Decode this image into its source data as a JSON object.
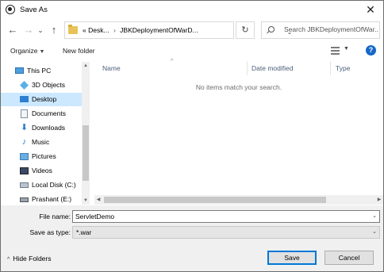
{
  "window": {
    "title": "Save As",
    "close_glyph": "✕"
  },
  "nav": {
    "back_glyph": "←",
    "forward_glyph": "→",
    "recent_glyph": "⌄",
    "up_glyph": "↑",
    "address": {
      "prefix": "«",
      "segments": [
        "Desk...",
        "JBKDeploymentOfWarD..."
      ],
      "separator": "›",
      "dropdown_glyph": "⌄"
    },
    "refresh_glyph": "↻",
    "search_placeholder": "Search JBKDeploymentOfWar..."
  },
  "toolbar": {
    "organize": "Organize",
    "organize_caret": "▼",
    "new_folder": "New folder",
    "view_caret": "▼",
    "help_glyph": "?"
  },
  "tree": [
    {
      "label": "This PC",
      "icon": "pc-icon",
      "level": 0
    },
    {
      "label": "3D Objects",
      "icon": "3d-objects-icon",
      "level": 1
    },
    {
      "label": "Desktop",
      "icon": "desktop-icon",
      "level": 1,
      "selected": true
    },
    {
      "label": "Documents",
      "icon": "documents-icon",
      "level": 1
    },
    {
      "label": "Downloads",
      "icon": "downloads-icon",
      "level": 1
    },
    {
      "label": "Music",
      "icon": "music-icon",
      "level": 1
    },
    {
      "label": "Pictures",
      "icon": "pictures-icon",
      "level": 1
    },
    {
      "label": "Videos",
      "icon": "videos-icon",
      "level": 1
    },
    {
      "label": "Local Disk (C:)",
      "icon": "local-disk-icon",
      "level": 1
    },
    {
      "label": "Prashant (E:)",
      "icon": "drive-icon",
      "level": 1
    }
  ],
  "columns": {
    "name": "Name",
    "date_modified": "Date modified",
    "type": "Type",
    "sort_glyph": "^"
  },
  "empty_message": "No items match your search.",
  "scroll_glyphs": {
    "up": "▲",
    "down": "▼",
    "left": "◀",
    "right": "▶"
  },
  "form": {
    "file_name_label": "File name:",
    "file_name_value": "ServletDemo",
    "save_as_type_label": "Save as type:",
    "save_as_type_value": "*.war",
    "dropdown_glyph": "⌄"
  },
  "footer": {
    "hide_folders": "Hide Folders",
    "hide_glyph": "^",
    "save": "Save",
    "cancel": "Cancel"
  },
  "colors": {
    "selection": "#cce8ff",
    "accent": "#0078d7",
    "help": "#1667c8",
    "folder": "#e8c35a"
  }
}
